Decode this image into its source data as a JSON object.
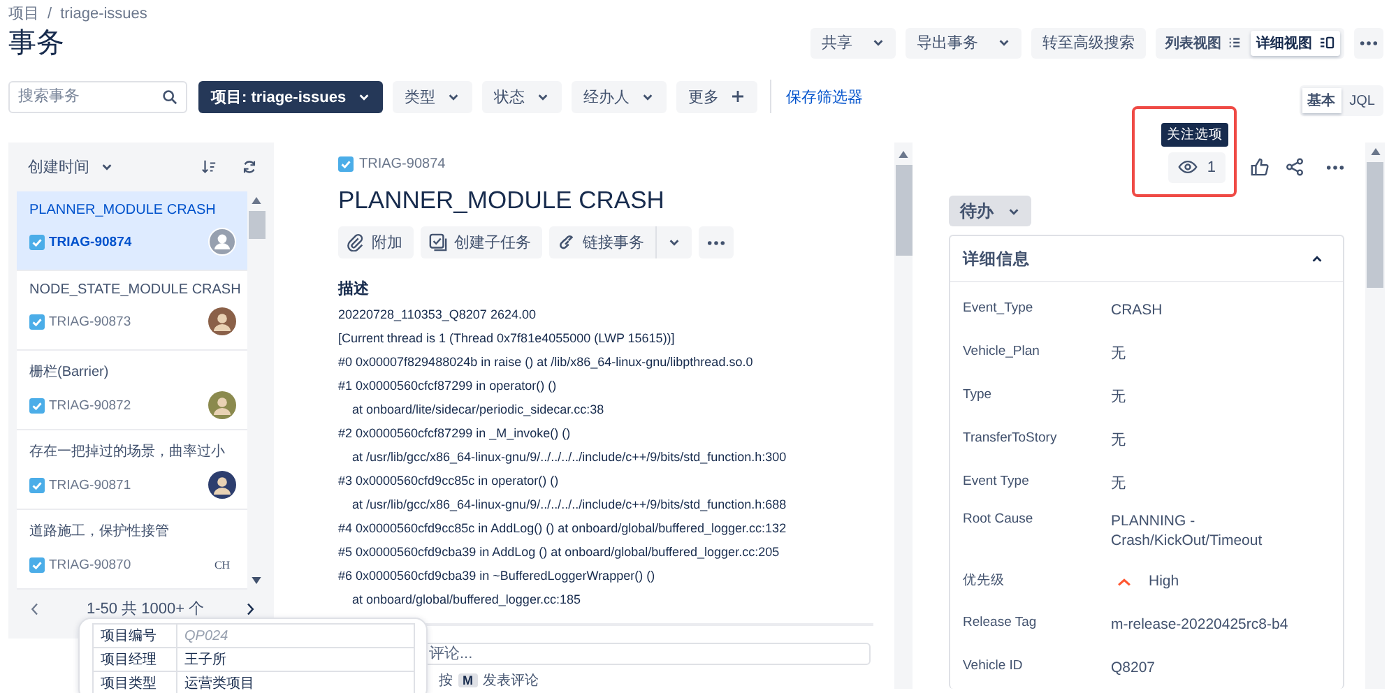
{
  "breadcrumb": [
    {
      "label": "项目"
    },
    {
      "label": "triage-issues"
    }
  ],
  "breadcrumb_separator": "/",
  "page_title": "事务",
  "actions": [
    {
      "label": "共享",
      "kind": "dropdown"
    },
    {
      "label": "导出事务",
      "kind": "dropdown"
    },
    {
      "label": "转至高级搜索",
      "kind": "plain"
    }
  ],
  "view_toggle": [
    {
      "label": "列表视图",
      "kind": "list",
      "selected": false
    },
    {
      "label": "详细视图",
      "kind": "detail",
      "selected": true
    }
  ],
  "filters": {
    "search": {
      "placeholder": "搜索事务"
    },
    "items": [
      {
        "label": "项目: triage-issues",
        "kind": "project"
      },
      {
        "label": "类型",
        "kind": "dropdown"
      },
      {
        "label": "状态",
        "kind": "dropdown"
      },
      {
        "label": "经办人",
        "kind": "dropdown"
      },
      {
        "label": "更多",
        "kind": "add"
      }
    ],
    "save_link": "保存筛选器"
  },
  "query_mode": [
    {
      "label": "基本",
      "selected": true
    },
    {
      "label": "JQL",
      "selected": false
    }
  ],
  "issue_list": {
    "sort_label": "创建时间",
    "items": [
      {
        "title": "PLANNER_MODULE CRASH",
        "key": "TRIAG-90874",
        "selected": true,
        "avatar": {
          "kind": "silhouette"
        }
      },
      {
        "title": "NODE_STATE_MODULE CRASH",
        "key": "TRIAG-90873",
        "selected": false,
        "avatar": {
          "kind": "photo",
          "color": "#8a6048"
        }
      },
      {
        "title": "栅栏(Barrier)",
        "key": "TRIAG-90872",
        "selected": false,
        "avatar": {
          "kind": "photo",
          "color": "#8b8a4e"
        }
      },
      {
        "title": "存在一把掉过的场景，曲率过小",
        "key": "TRIAG-90871",
        "selected": false,
        "avatar": {
          "kind": "photo",
          "color": "#2d3e6e"
        }
      },
      {
        "title": "道路施工，保护性接管",
        "key": "TRIAG-90870",
        "selected": false,
        "avatar": {
          "kind": "initials",
          "text": "CH"
        }
      }
    ],
    "pagination": "1-50  共 1000+ 个"
  },
  "issue": {
    "key": "TRIAG-90874",
    "title": "PLANNER_MODULE CRASH",
    "buttons": [
      {
        "label": "附加",
        "kind": "attach"
      },
      {
        "label": "创建子任务",
        "kind": "subtask"
      },
      {
        "label": "链接事务",
        "kind": "link"
      }
    ],
    "description_heading": "描述",
    "description": [
      {
        "kind": "text",
        "text": "20220728_110353_Q8207   2624.00"
      },
      {
        "kind": "text",
        "text": "[Current thread is 1 (Thread 0x7f81e4055000 (LWP 15615))]"
      },
      {
        "kind": "frame",
        "text": "#0  0x00007f829488024b in raise () at /lib/x86_64-linux-gnu/libpthread.so.0"
      },
      {
        "kind": "frame",
        "text": "#1  0x0000560cfcf87299 in operator() ()"
      },
      {
        "kind": "location",
        "text": "at onboard/lite/sidecar/periodic_sidecar.cc:38"
      },
      {
        "kind": "frame",
        "text": "#2  0x0000560cfcf87299 in _M_invoke() ()"
      },
      {
        "kind": "location",
        "text": "at /usr/lib/gcc/x86_64-linux-gnu/9/../../../../include/c++/9/bits/std_function.h:300"
      },
      {
        "kind": "frame",
        "text": "#3  0x0000560cfd9cc85c in operator() ()"
      },
      {
        "kind": "location",
        "text": "at /usr/lib/gcc/x86_64-linux-gnu/9/../../../../include/c++/9/bits/std_function.h:688"
      },
      {
        "kind": "frame",
        "text": "#4  0x0000560cfd9cc85c in AddLog() () at onboard/global/buffered_logger.cc:132"
      },
      {
        "kind": "frame",
        "text": "#5  0x0000560cfd9cba39 in AddLog () at onboard/global/buffered_logger.cc:205"
      },
      {
        "kind": "frame",
        "text": "#6  0x0000560cfd9cba39 in ~BufferedLoggerWrapper() ()"
      },
      {
        "kind": "location",
        "text": "at onboard/global/buffered_logger.cc:185"
      }
    ],
    "comment_placeholder": "评论...",
    "comment_hint": {
      "before": "按",
      "key": "M",
      "after": "发表评论"
    }
  },
  "watchers": {
    "tooltip": "关注选项",
    "count": "1",
    "highlighted": true
  },
  "status": "待办",
  "details": {
    "title": "详细信息",
    "expanded": true,
    "fields": [
      {
        "label": "Event_Type",
        "value": "CRASH",
        "kind": "text"
      },
      {
        "label": "Vehicle_Plan",
        "value": "无",
        "kind": "text"
      },
      {
        "label": "Type",
        "value": "无",
        "kind": "text"
      },
      {
        "label": "TransferToStory",
        "value": "无",
        "kind": "text"
      },
      {
        "label": "Event Type",
        "value": "无",
        "kind": "text"
      },
      {
        "label": "Root Cause",
        "value": "PLANNING - Crash/KickOut/Timeout",
        "kind": "text"
      },
      {
        "label": "优先级",
        "value": "High",
        "kind": "priority"
      },
      {
        "label": "Release Tag",
        "value": "m-release-20220425rc8-b4",
        "kind": "text"
      },
      {
        "label": "Vehicle ID",
        "value": "Q8207",
        "kind": "text"
      }
    ]
  },
  "popup_table": [
    {
      "label": "项目编号",
      "value": "QP024",
      "muted": true
    },
    {
      "label": "项目经理",
      "value": "王子所",
      "muted": false
    },
    {
      "label": "项目类型",
      "value": "运营类项目",
      "muted": false
    }
  ]
}
